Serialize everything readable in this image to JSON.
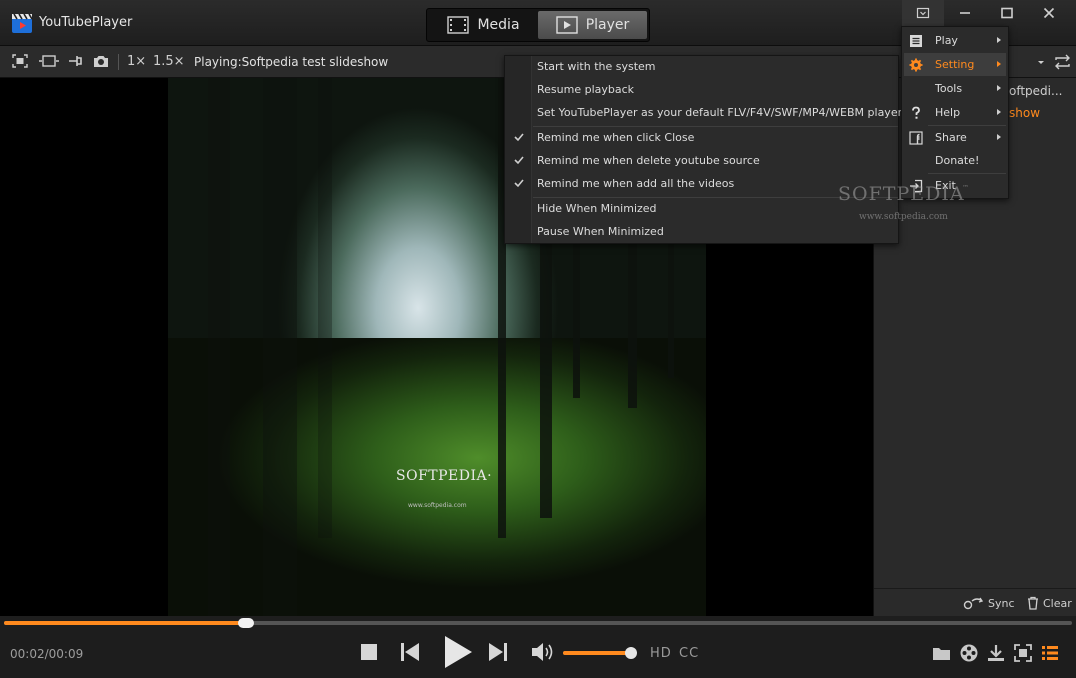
{
  "app": {
    "title": "YouTubePlayer"
  },
  "mode_tabs": [
    {
      "label": "Media",
      "icon": "film-icon",
      "active": false
    },
    {
      "label": "Player",
      "icon": "play-box-icon",
      "active": true
    }
  ],
  "toolbar": {
    "speed_1x": "1×",
    "speed_15x": "1.5×",
    "now_playing": "Playing:Softpedia test slideshow"
  },
  "video": {
    "watermark": "SOFTPEDIA·",
    "watermark_url": "www.softpedia.com"
  },
  "playlist": {
    "item_1": "oftpedi...",
    "item_2": "show",
    "sync_label": "Sync",
    "clear_label": "Clear"
  },
  "playback": {
    "time": "00:02/00:09",
    "progress": 0.227,
    "volume": 0.97,
    "hd_label": "HD",
    "cc_label": "CC"
  },
  "main_menu": {
    "items": [
      {
        "label": "Play",
        "icon": "list-icon",
        "has_submenu": true,
        "highlighted": false
      },
      {
        "label": "Setting",
        "icon": "gear-icon",
        "has_submenu": true,
        "highlighted": true
      },
      {
        "label": "Tools",
        "icon": "",
        "has_submenu": true,
        "highlighted": false
      },
      {
        "label": "Help",
        "icon": "question-icon",
        "has_submenu": true,
        "highlighted": false
      },
      {
        "label": "Share",
        "icon": "facebook-icon",
        "has_submenu": true,
        "highlighted": false
      },
      {
        "label": "Donate!",
        "icon": "",
        "has_submenu": false,
        "highlighted": false
      },
      {
        "label": "Exit",
        "icon": "exit-icon",
        "has_submenu": false,
        "highlighted": false
      }
    ]
  },
  "setting_submenu": {
    "items": [
      {
        "label": "Start with the system",
        "checked": false
      },
      {
        "label": "Resume playback",
        "checked": false
      },
      {
        "label": "Set YouTubePlayer as your default FLV/F4V/SWF/MP4/WEBM player",
        "checked": false
      },
      {
        "label": "Remind me when click Close",
        "checked": true
      },
      {
        "label": "Remind me when delete youtube source",
        "checked": true
      },
      {
        "label": "Remind me when add all the videos",
        "checked": true
      },
      {
        "label": "Hide When Minimized",
        "checked": false
      },
      {
        "label": "Pause When Minimized",
        "checked": false
      }
    ]
  },
  "overlay_watermark": {
    "text": "SOFTPEDIA",
    "tm": "™",
    "url": "www.softpedia.com"
  },
  "colors": {
    "accent": "#ff8a1e",
    "background": "#1a1a1a",
    "menu_bg": "#2b2b2b"
  }
}
